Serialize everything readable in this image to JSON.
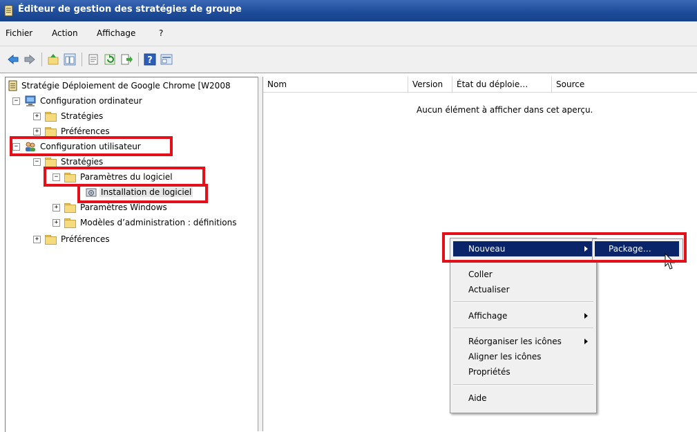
{
  "window": {
    "title": "Éditeur de gestion des stratégies de groupe"
  },
  "menu": {
    "items": [
      "Fichier",
      "Action",
      "Affichage",
      "?"
    ]
  },
  "toolbar": {
    "buttons": [
      "back-icon",
      "forward-icon",
      "up-folder-icon",
      "show-hide-tree-icon",
      "properties-icon",
      "refresh-icon",
      "export-list-icon",
      "help-icon",
      "console-view-icon"
    ]
  },
  "tree": {
    "root": "Stratégie Déploiement de Google Chrome [W2008",
    "computer_config": "Configuration ordinateur",
    "computer_strategies": "Stratégies",
    "computer_preferences": "Préférences",
    "user_config": "Configuration utilisateur",
    "user_strategies": "Stratégies",
    "software_settings": "Paramètres du logiciel",
    "software_installation": "Installation de logiciel",
    "windows_settings": "Paramètres Windows",
    "admin_templates": "Modèles d’administration : définitions",
    "user_preferences": "Préférences"
  },
  "list": {
    "columns": [
      "Nom",
      "Version",
      "État du déploie…",
      "Source"
    ],
    "empty_message": "Aucun élément à afficher dans cet aperçu."
  },
  "context_menu": {
    "nouveau": "Nouveau",
    "coller": "Coller",
    "actualiser": "Actualiser",
    "affichage": "Affichage",
    "reorganiser": "Réorganiser les icônes",
    "aligner": "Aligner les icônes",
    "proprietes": "Propriétés",
    "aide": "Aide"
  },
  "submenu": {
    "package": "Package…"
  },
  "colors": {
    "highlight_box": "#e3101a",
    "menu_selection": "#0a246a",
    "titlebar": "#1f4d9b"
  }
}
